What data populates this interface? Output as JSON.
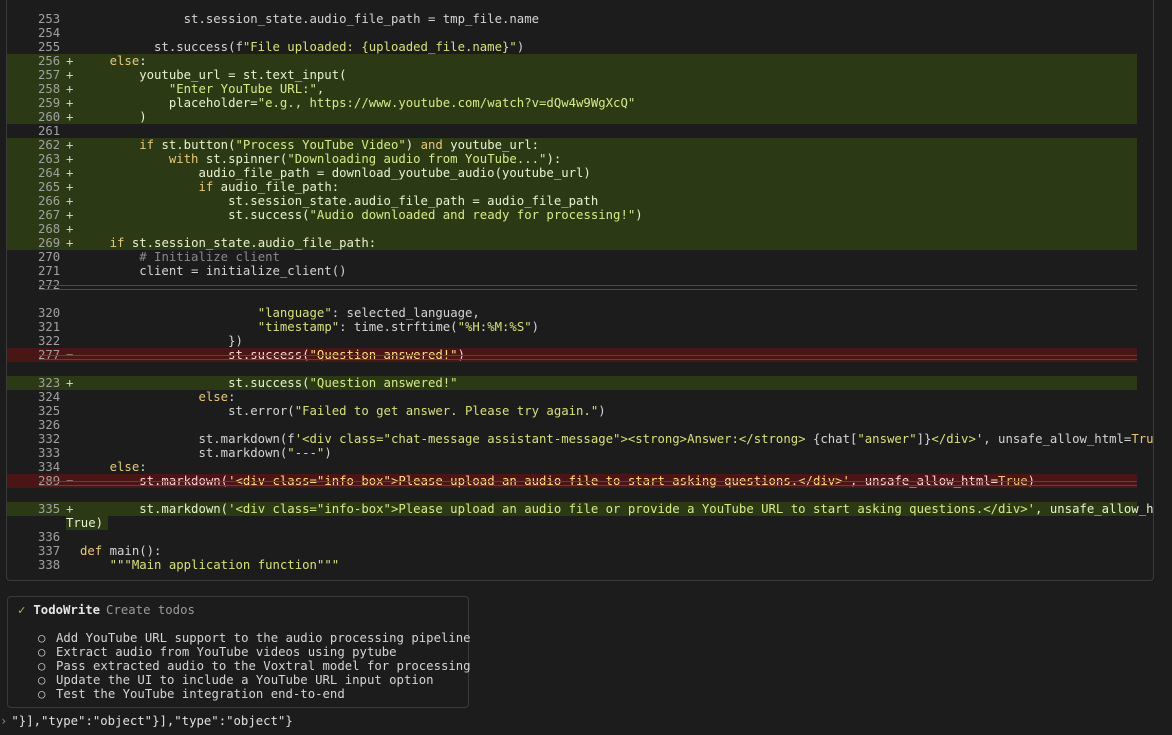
{
  "diff": {
    "lines": [
      {
        "ln": "253",
        "mk": "",
        "type": "ctx",
        "segs": [
          {
            "t": "              st.session_state.audio_file_path = tmp_file.name"
          }
        ]
      },
      {
        "ln": "254",
        "mk": "",
        "type": "ctx",
        "segs": [
          {
            "t": ""
          }
        ]
      },
      {
        "ln": "255",
        "mk": "",
        "type": "ctx",
        "segs": [
          {
            "t": "          st.success(f"
          },
          {
            "t": "\"File uploaded: {uploaded_file.name}\"",
            "c": "str"
          },
          {
            "t": ")"
          }
        ]
      },
      {
        "ln": "256",
        "mk": "+",
        "type": "add",
        "segs": [
          {
            "t": "    "
          },
          {
            "t": "else",
            "c": "kw"
          },
          {
            "t": ":"
          }
        ]
      },
      {
        "ln": "257",
        "mk": "+",
        "type": "add",
        "segs": [
          {
            "t": "        youtube_url = st.text_input("
          }
        ]
      },
      {
        "ln": "258",
        "mk": "+",
        "type": "add",
        "segs": [
          {
            "t": "            "
          },
          {
            "t": "\"Enter YouTube URL:\"",
            "c": "str"
          },
          {
            "t": ","
          }
        ]
      },
      {
        "ln": "259",
        "mk": "+",
        "type": "add",
        "segs": [
          {
            "t": "            placeholder="
          },
          {
            "t": "\"e.g., https://www.youtube.com/watch?v=dQw4w9WgXcQ\"",
            "c": "str"
          }
        ]
      },
      {
        "ln": "260",
        "mk": "+",
        "type": "add",
        "segs": [
          {
            "t": "        )"
          }
        ]
      },
      {
        "ln": "261",
        "mk": "",
        "type": "ctx",
        "segs": [
          {
            "t": ""
          }
        ]
      },
      {
        "ln": "262",
        "mk": "+",
        "type": "add",
        "segs": [
          {
            "t": "        "
          },
          {
            "t": "if",
            "c": "kw"
          },
          {
            "t": " st.button("
          },
          {
            "t": "\"Process YouTube Video\"",
            "c": "str"
          },
          {
            "t": ") "
          },
          {
            "t": "and",
            "c": "kw"
          },
          {
            "t": " youtube_url:"
          }
        ]
      },
      {
        "ln": "263",
        "mk": "+",
        "type": "add",
        "segs": [
          {
            "t": "            "
          },
          {
            "t": "with",
            "c": "kw"
          },
          {
            "t": " st.spinner("
          },
          {
            "t": "\"Downloading audio from YouTube...\"",
            "c": "str"
          },
          {
            "t": "):"
          }
        ]
      },
      {
        "ln": "264",
        "mk": "+",
        "type": "add",
        "segs": [
          {
            "t": "                audio_file_path = download_youtube_audio(youtube_url)"
          }
        ]
      },
      {
        "ln": "265",
        "mk": "+",
        "type": "add",
        "segs": [
          {
            "t": "                "
          },
          {
            "t": "if",
            "c": "kw"
          },
          {
            "t": " audio_file_path:"
          }
        ]
      },
      {
        "ln": "266",
        "mk": "+",
        "type": "add",
        "segs": [
          {
            "t": "                    st.session_state.audio_file_path = audio_file_path"
          }
        ]
      },
      {
        "ln": "267",
        "mk": "+",
        "type": "add",
        "segs": [
          {
            "t": "                    st.success("
          },
          {
            "t": "\"Audio downloaded and ready for processing!\"",
            "c": "str"
          },
          {
            "t": ")"
          }
        ]
      },
      {
        "ln": "268",
        "mk": "+",
        "type": "add",
        "segs": [
          {
            "t": ""
          }
        ]
      },
      {
        "ln": "269",
        "mk": "+",
        "type": "add",
        "segs": [
          {
            "t": "    "
          },
          {
            "t": "if",
            "c": "kw"
          },
          {
            "t": " st.session_state.audio_file_path:"
          }
        ]
      },
      {
        "ln": "270",
        "mk": "",
        "type": "ctx",
        "segs": [
          {
            "t": "        "
          },
          {
            "t": "# Initialize client",
            "c": "cm"
          }
        ]
      },
      {
        "ln": "271",
        "mk": "",
        "type": "ctx",
        "segs": [
          {
            "t": "        client = initialize_client()"
          }
        ]
      },
      {
        "ln": "272",
        "mk": "",
        "type": "ctx",
        "segs": [
          {
            "t": ""
          }
        ]
      },
      {
        "sep": true
      },
      {
        "ln": "320",
        "mk": "",
        "type": "ctx",
        "segs": [
          {
            "t": "                        "
          },
          {
            "t": "\"language\"",
            "c": "str"
          },
          {
            "t": ": selected_language,"
          }
        ]
      },
      {
        "ln": "321",
        "mk": "",
        "type": "ctx",
        "segs": [
          {
            "t": "                        "
          },
          {
            "t": "\"timestamp\"",
            "c": "str"
          },
          {
            "t": ": time.strftime("
          },
          {
            "t": "\"%H:%M:%S\"",
            "c": "str"
          },
          {
            "t": ")"
          }
        ]
      },
      {
        "ln": "322",
        "mk": "",
        "type": "ctx",
        "segs": [
          {
            "t": "                    })"
          }
        ]
      },
      {
        "ln": "277",
        "mk": "−",
        "type": "del",
        "segs": [
          {
            "t": "                    st.success("
          },
          {
            "t": "\"Question answered!\"",
            "c": "str"
          },
          {
            "t": ")"
          }
        ]
      },
      {
        "sep": true
      },
      {
        "ln": "323",
        "mk": "+",
        "type": "add",
        "segs": [
          {
            "t": "                    st.success("
          },
          {
            "t": "\"Question answered!\"",
            "c": "str"
          }
        ]
      },
      {
        "ln": "324",
        "mk": "",
        "type": "ctx",
        "segs": [
          {
            "t": "                "
          },
          {
            "t": "else",
            "c": "kw"
          },
          {
            "t": ":"
          }
        ]
      },
      {
        "ln": "325",
        "mk": "",
        "type": "ctx",
        "segs": [
          {
            "t": "                    st.error("
          },
          {
            "t": "\"Failed to get answer. Please try again.\"",
            "c": "str"
          },
          {
            "t": ")"
          }
        ]
      },
      {
        "ln": "326",
        "mk": "",
        "type": "ctx",
        "segs": [
          {
            "t": ""
          }
        ]
      },
      {
        "ln": "332",
        "mk": "",
        "type": "ctx",
        "segs": [
          {
            "t": "                st.markdown(f"
          },
          {
            "t": "'<div class=\"chat-message assistant-message\"><strong>Answer:</strong> ",
            "c": "str"
          },
          {
            "t": "{chat["
          },
          {
            "t": "\"answer\"",
            "c": "str"
          },
          {
            "t": "]}"
          },
          {
            "t": "</div>'",
            "c": "str"
          },
          {
            "t": ", unsafe_allow_html="
          },
          {
            "t": "True",
            "c": "kw"
          },
          {
            "t": ")"
          }
        ]
      },
      {
        "ln": "333",
        "mk": "",
        "type": "ctx",
        "segs": [
          {
            "t": "                st.markdown("
          },
          {
            "t": "\"---\"",
            "c": "str"
          },
          {
            "t": ")"
          }
        ]
      },
      {
        "ln": "334",
        "mk": "",
        "type": "ctx",
        "segs": [
          {
            "t": "    "
          },
          {
            "t": "else",
            "c": "kw"
          },
          {
            "t": ":"
          }
        ]
      },
      {
        "ln": "289",
        "mk": "−",
        "type": "del",
        "segs": [
          {
            "t": "        st.markdown("
          },
          {
            "t": "'<div class=\"info-box\">Please upload an audio file to start asking questions.</div>'",
            "c": "str"
          },
          {
            "t": ", unsafe_allow_html="
          },
          {
            "t": "True",
            "c": "kw"
          },
          {
            "t": ")"
          }
        ]
      },
      {
        "sep": true
      },
      {
        "ln": "335",
        "mk": "+",
        "type": "add",
        "segs": [
          {
            "t": "        st.markdown("
          },
          {
            "t": "'<div class=\"info-box\">Please upload an audio file or provide a YouTube URL to start asking questions.</div>'",
            "c": "str"
          },
          {
            "t": ", unsafe_allow_html="
          }
        ],
        "cont": "True)"
      },
      {
        "ln": "336",
        "mk": "",
        "type": "ctx",
        "segs": [
          {
            "t": ""
          }
        ]
      },
      {
        "ln": "337",
        "mk": "",
        "type": "ctx",
        "segs": [
          {
            "t": ""
          },
          {
            "t": "def",
            "c": "kw"
          },
          {
            "t": " main():"
          }
        ]
      },
      {
        "ln": "338",
        "mk": "",
        "type": "ctx",
        "segs": [
          {
            "t": "    "
          },
          {
            "t": "\"\"\"Main application function\"\"\"",
            "c": "str"
          }
        ]
      }
    ]
  },
  "todo": {
    "check": "✓",
    "tool": "TodoWrite",
    "desc": "Create todos",
    "bullet": "○",
    "items": [
      "Add YouTube URL support to the audio processing pipeline",
      "Extract audio from YouTube videos using pytube",
      "Pass extracted audio to the Voxtral model for processing",
      "Update the UI to include a YouTube URL input option",
      "Test the YouTube integration end-to-end"
    ]
  },
  "json_tail": {
    "caret": "›",
    "text": "\"}],\"type\":\"object\"}],\"type\":\"object\"}"
  },
  "colors": {
    "add_bg": "#2b3a14",
    "del_bg": "#4a1515",
    "string": "#d7e07a",
    "keyword": "#e7c87a"
  }
}
